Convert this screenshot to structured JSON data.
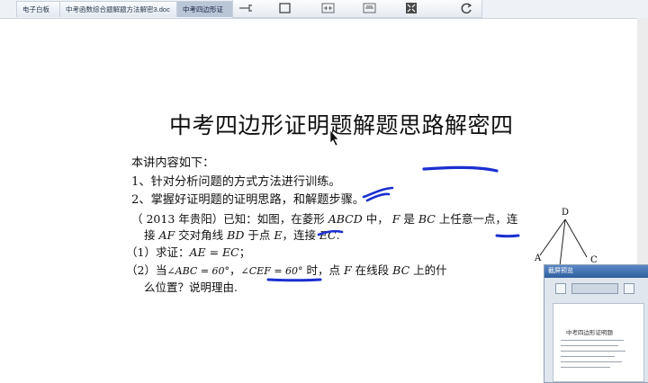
{
  "tabs": [
    {
      "label": "电子白板"
    },
    {
      "label": "中考函数综合题解题方法解密3.doc"
    },
    {
      "label": "中考四边形证"
    }
  ],
  "toolbar": {
    "icons": [
      "pin-icon",
      "square-icon",
      "split-icon",
      "split-icon",
      "fullscreen-icon",
      "refresh-icon"
    ]
  },
  "slide": {
    "title": "中考四边形证明题解题思路解密四",
    "intro": "本讲内容如下：",
    "point1": "1、针对分析问题的方式方法进行训练。",
    "point2": "2、掌握好证明题的证明思路，和解题步骤。",
    "problem": {
      "line1_a": "（ 2013 年贵阳）已知：如图，在菱形 ",
      "line1_b": "ABCD",
      "line1_c": " 中， ",
      "line1_d": "F",
      "line1_e": " 是 ",
      "line1_f": "BC",
      "line1_g": " 上任意一点，连",
      "line2_a": "接 ",
      "line2_b": "AF",
      "line2_c": " 交对角线 ",
      "line2_d": "BD",
      "line2_e": " 于点 ",
      "line2_f": "E",
      "line2_g": "，连接 ",
      "line2_h": "EC",
      "line2_i": ".",
      "q1_a": "（1）求证：",
      "q1_b": "AE = EC",
      "q1_c": "；",
      "q2_a": "（2）当",
      "q2_b": "∠ABC = 60°",
      "q2_c": "，",
      "q2_d": "∠CEF = 60°",
      "q2_e": " 时，点 ",
      "q2_f": "F",
      "q2_g": " 在线段 ",
      "q2_h": "BC",
      "q2_i": " 上的什",
      "q2_line2": "么位置？说明理由."
    },
    "figure_labels": {
      "d": "D",
      "a": "A",
      "c": "C"
    }
  },
  "preview": {
    "title": "截屏预览",
    "page_title": "中考四边形证明题"
  },
  "colors": {
    "annotation": "#1a2fd0",
    "tab_bg": "#eef2f7"
  }
}
